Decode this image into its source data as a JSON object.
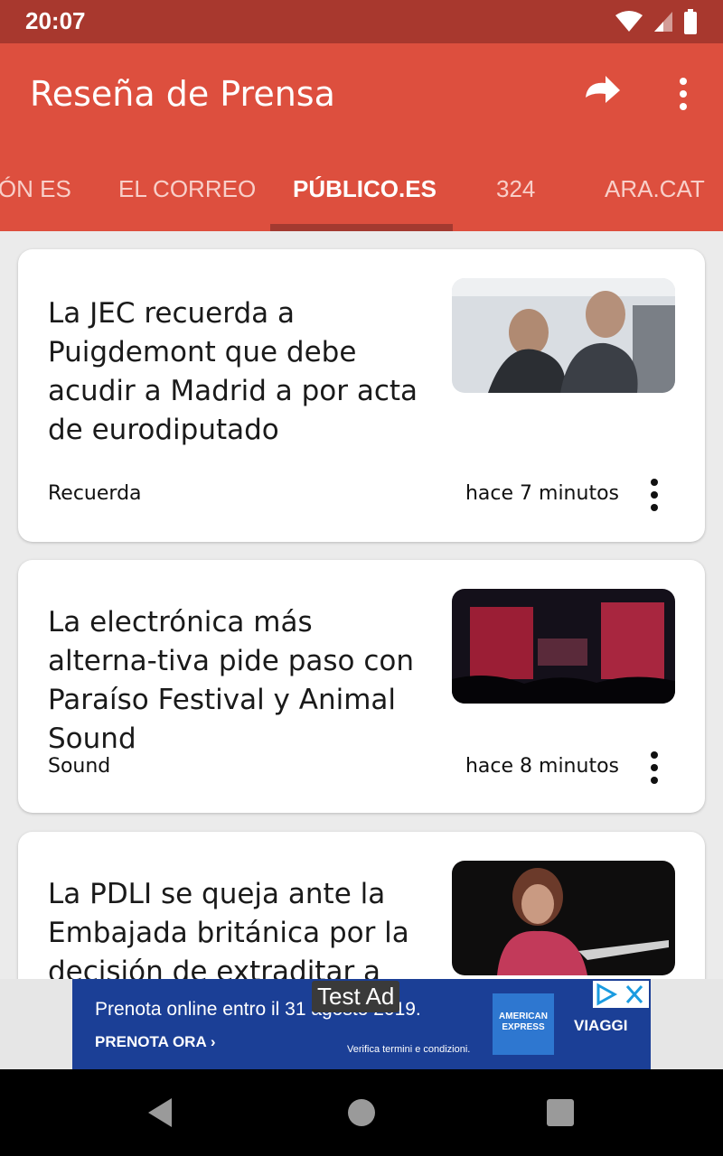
{
  "status_bar": {
    "time": "20:07"
  },
  "app_bar": {
    "title": "Reseña de Prensa",
    "refresh_icon": "refresh-icon",
    "more_icon": "more-vert-icon"
  },
  "tabs": [
    {
      "label": "ZÓN ES"
    },
    {
      "label": "EL CORREO"
    },
    {
      "label": "PÚBLICO.ES",
      "active": true
    },
    {
      "label": "324"
    },
    {
      "label": "ARA.CAT"
    }
  ],
  "articles": [
    {
      "headline": "La JEC recuerda a Puigdemont que debe acudir a Madrid a por acta de eurodiputado",
      "source": "Recuerda",
      "time": "hace 7 minutos"
    },
    {
      "headline": "La electrónica más alterna-tiva pide paso con Paraíso Festival y Animal Sound",
      "source": "Sound",
      "time": "hace 8 minutos"
    },
    {
      "headline": "La PDLI se queja ante la Embajada británica por la decisión de extraditar a",
      "source": "",
      "time": ""
    }
  ],
  "ad": {
    "label": "Test Ad",
    "line1": "Prenota online entro il 31 agosto 2019.",
    "cta": "PRENOTA ORA",
    "terms": "Verifica termini e condizioni.",
    "brand": "AMERICAN EXPRESS",
    "viaggi": "VIAGGI"
  },
  "colors": {
    "app_bar": "#dd4f3e",
    "status_bar": "#a8382e",
    "tab_indicator": "#a33a30",
    "ad_bg": "#1b3f96"
  }
}
